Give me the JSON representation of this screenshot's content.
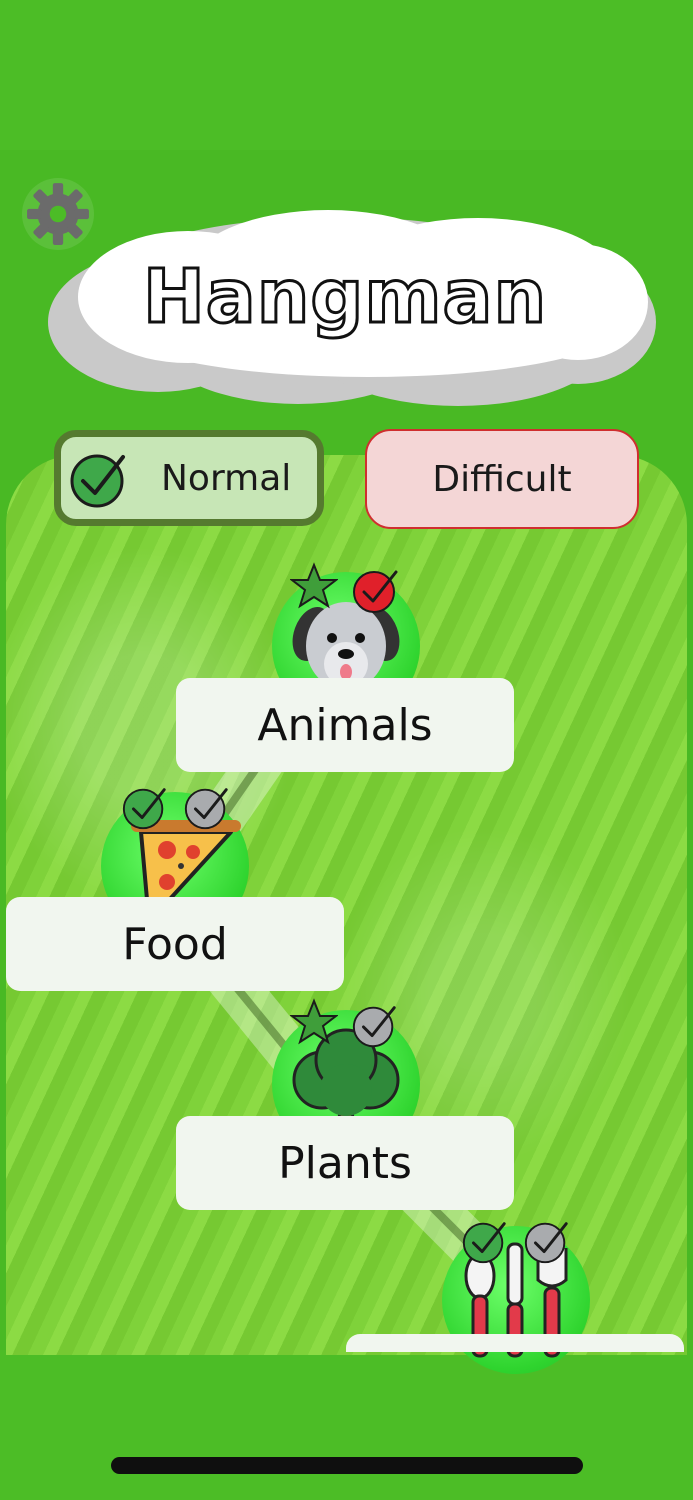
{
  "app": {
    "title": "Hangman"
  },
  "settings": {
    "icon": "gear-icon"
  },
  "difficulty": {
    "normal_label": "Normal",
    "difficult_label": "Difficult",
    "selected": "Normal"
  },
  "categories": [
    {
      "label": "Animals",
      "icon": "dog-icon",
      "star": true,
      "check_status": "red"
    },
    {
      "label": "Food",
      "icon": "pizza-icon",
      "star": false,
      "check_status": "green-and-gray"
    },
    {
      "label": "Plants",
      "icon": "tree-icon",
      "star": true,
      "check_status": "gray"
    },
    {
      "label": "",
      "icon": "utensils-icon",
      "star": false,
      "check_status": "green-and-gray"
    }
  ],
  "colors": {
    "background": "#4cbc27",
    "node": "#2fd42e",
    "normal_border": "#557a2f",
    "difficult_border": "#cf2f2f"
  }
}
